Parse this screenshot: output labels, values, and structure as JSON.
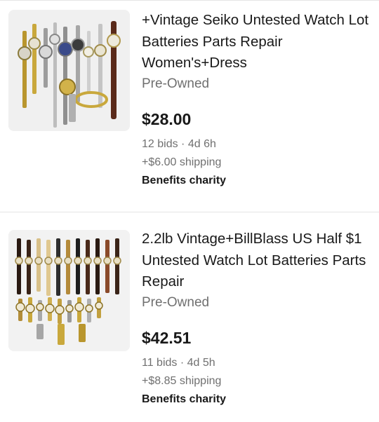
{
  "listings": [
    {
      "title": "+Vintage Seiko Untested Watch Lot Batteries Parts Repair Women's+Dress",
      "condition": "Pre-Owned",
      "price": "$28.00",
      "bids": "12 bids",
      "time_left": "4d 6h",
      "shipping": "+$6.00 shipping",
      "charity": "Benefits charity"
    },
    {
      "title": "2.2lb Vintage+BillBlass US Half $1 Untested Watch Lot Batteries Parts Repair",
      "condition": "Pre-Owned",
      "price": "$42.51",
      "bids": "11 bids",
      "time_left": "4d 5h",
      "shipping": "+$8.85 shipping",
      "charity": "Benefits charity"
    }
  ],
  "separator": "·",
  "colors": {
    "text_primary": "#191919",
    "text_secondary": "#707070",
    "divider": "#e5e5e5",
    "thumb_bg": "#efefef"
  }
}
